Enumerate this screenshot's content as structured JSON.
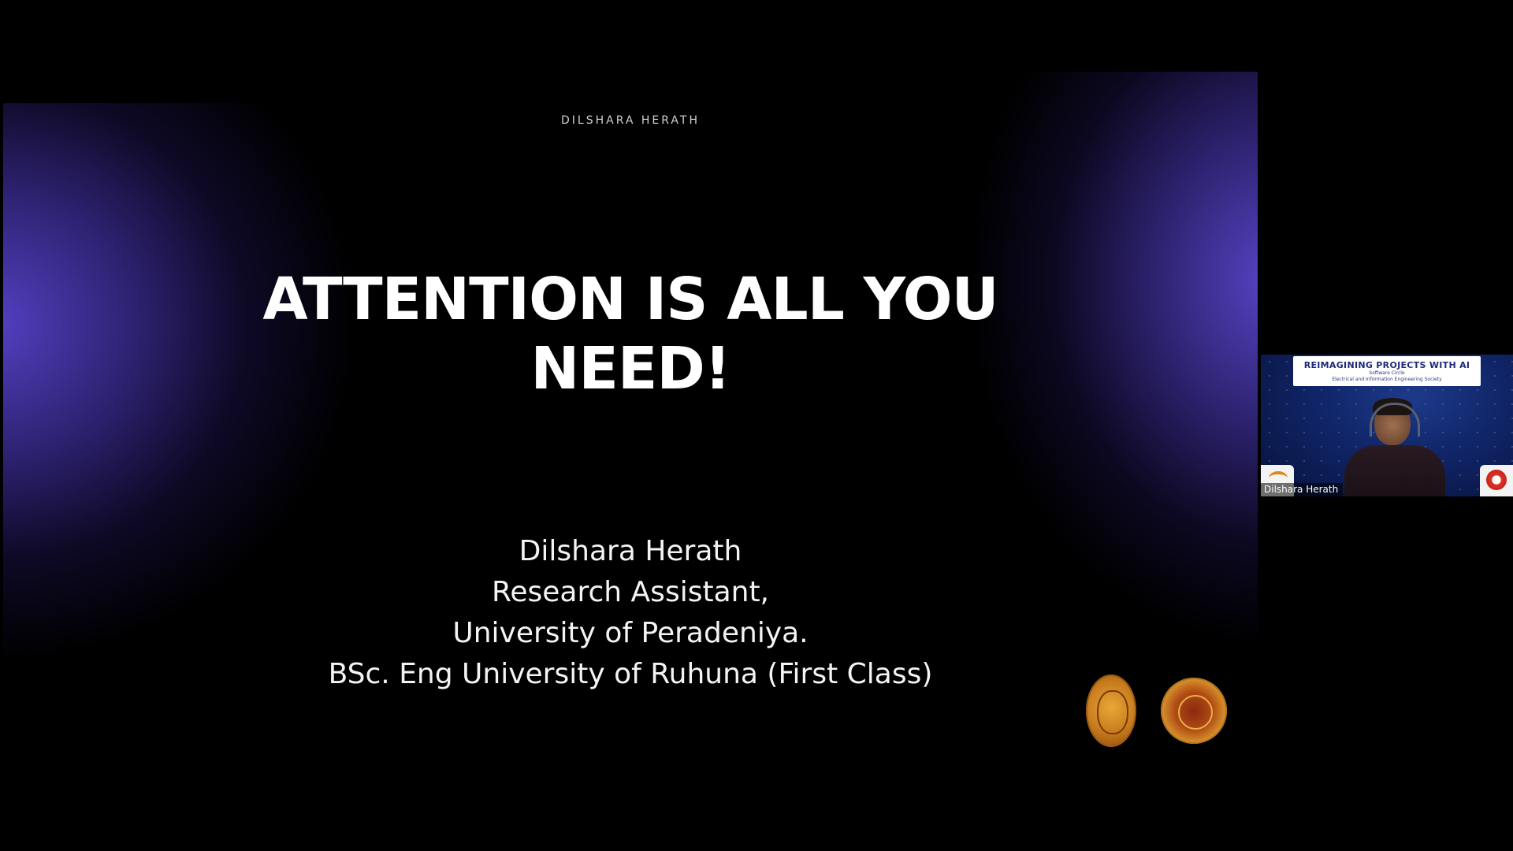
{
  "slide": {
    "author_top": "DILSHARA HERATH",
    "title_line1": "ATTENTION IS ALL YOU",
    "title_line2": "NEED!",
    "credits": [
      "Dilshara Herath",
      "Research Assistant,",
      "University of Peradeniya.",
      "BSc. Eng University of Ruhuna (First Class)"
    ],
    "logos": [
      "university-of-ruhuna-crest",
      "university-of-peradeniya-seal"
    ]
  },
  "webcam": {
    "banner_title": "REIMAGINING PROJECTS WITH AI",
    "banner_sub1": "Software Circle",
    "banner_sub2": "Electrical and Information Engineering Society",
    "participant_name": "Dilshara Herath"
  }
}
